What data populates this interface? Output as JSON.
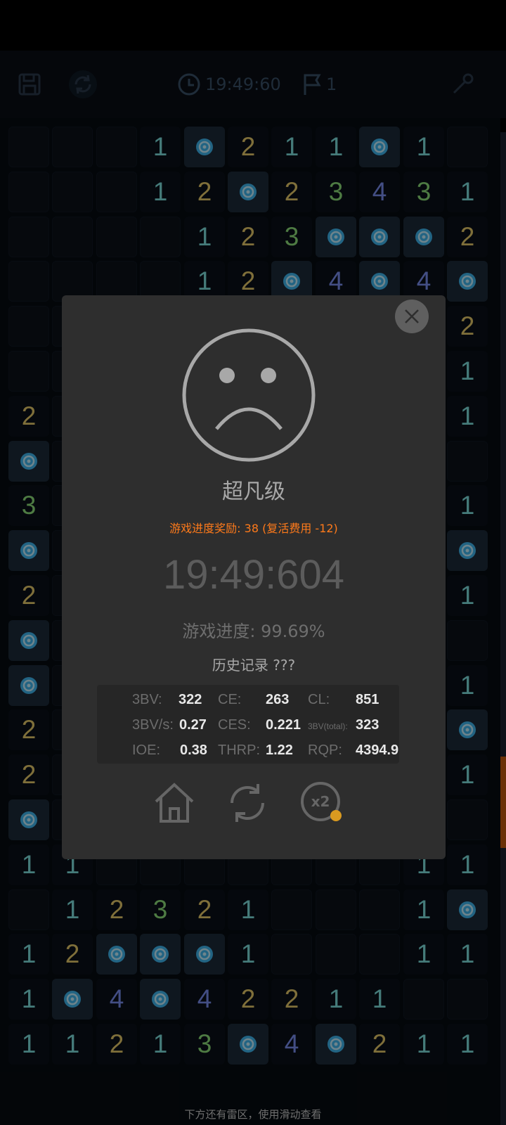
{
  "toolbar": {
    "time": "19:49:60",
    "flags": "1"
  },
  "board": {
    "rows": [
      [
        "",
        "",
        "",
        "1",
        "*",
        "2",
        "1",
        "1",
        "*",
        "1",
        ""
      ],
      [
        "",
        "",
        "",
        "1",
        "2",
        "*",
        "2",
        "3",
        "4",
        "3",
        "1"
      ],
      [
        "",
        "",
        "",
        "",
        "1",
        "2",
        "3",
        "*",
        "*",
        "*",
        "2"
      ],
      [
        "",
        "",
        "",
        "",
        "1",
        "2",
        "*",
        "4",
        "*",
        "4",
        "*"
      ],
      [
        "",
        "",
        "",
        "",
        "",
        "",
        "",
        "",
        "",
        "",
        "2"
      ],
      [
        "",
        "",
        "",
        "",
        "",
        "",
        "",
        "",
        "",
        "",
        "1"
      ],
      [
        "2",
        "",
        "",
        "",
        "",
        "",
        "",
        "",
        "",
        "",
        "1"
      ],
      [
        "*",
        "",
        "",
        "",
        "",
        "",
        "",
        "",
        "",
        "",
        ""
      ],
      [
        "3",
        "",
        "",
        "",
        "",
        "",
        "",
        "",
        "",
        "",
        "1"
      ],
      [
        "*",
        "",
        "",
        "",
        "",
        "",
        "",
        "",
        "",
        "",
        "*"
      ],
      [
        "2",
        "",
        "",
        "",
        "",
        "",
        "",
        "",
        "",
        "",
        "1"
      ],
      [
        "*",
        "",
        "",
        "",
        "",
        "",
        "",
        "",
        "",
        "",
        ""
      ],
      [
        "*",
        "",
        "",
        "",
        "",
        "",
        "",
        "",
        "",
        "",
        "1"
      ],
      [
        "2",
        "",
        "",
        "",
        "",
        "",
        "",
        "",
        "",
        "",
        "*"
      ],
      [
        "2",
        "",
        "",
        "",
        "",
        "",
        "",
        "",
        "",
        "",
        "1"
      ],
      [
        "*",
        "",
        "",
        "",
        "",
        "",
        "",
        "",
        "",
        "",
        ""
      ],
      [
        "1",
        "1",
        "",
        "",
        "",
        "",
        "",
        "",
        "",
        "1",
        "1"
      ],
      [
        "",
        "1",
        "2",
        "3",
        "2",
        "1",
        "",
        "",
        "",
        "1",
        "*"
      ],
      [
        "1",
        "2",
        "*",
        "*",
        "*",
        "1",
        "",
        "",
        "",
        "1",
        "1"
      ],
      [
        "1",
        "*",
        "4",
        "*",
        "4",
        "2",
        "2",
        "1",
        "1",
        "",
        ""
      ],
      [
        "1",
        "1",
        "2",
        "1",
        "3",
        "*",
        "4",
        "*",
        "2",
        "1",
        "1"
      ]
    ]
  },
  "dialog": {
    "rank": "超凡级",
    "reward": "游戏进度奖励: 38 (复活费用 -12)",
    "time": "19:49:604",
    "progress": "游戏进度: 99.69%",
    "history": "历史记录 ???",
    "stats": {
      "bv_label": "3BV:",
      "bv": "322",
      "ce_label": "CE:",
      "ce": "263",
      "cl_label": "CL:",
      "cl": "851",
      "bvs_label": "3BV/s:",
      "bvs": "0.27",
      "ces_label": "CES:",
      "ces": "0.221",
      "bvtotal_label": "3BV(total):",
      "bvtotal": "323",
      "ioe_label": "IOE:",
      "ioe": "0.38",
      "thrp_label": "THRP:",
      "thrp": "1.22",
      "rqp_label": "RQP:",
      "rqp": "4394.9"
    },
    "double_label": "x2"
  },
  "bottom_hint": "下方还有雷区，使用滑动查看",
  "icons": [
    "save-icon",
    "refresh-icon",
    "clock-icon",
    "flag-icon",
    "tool-icon",
    "close-icon",
    "sad-face-icon",
    "home-icon",
    "restart-icon",
    "double-reward-icon",
    "mine-icon"
  ],
  "colors": {
    "accent_orange": "#ff7a1a",
    "num1": "#7fe0de",
    "num2": "#e7cb6a",
    "num3": "#8fe07a",
    "num4": "#7a8ff0"
  }
}
